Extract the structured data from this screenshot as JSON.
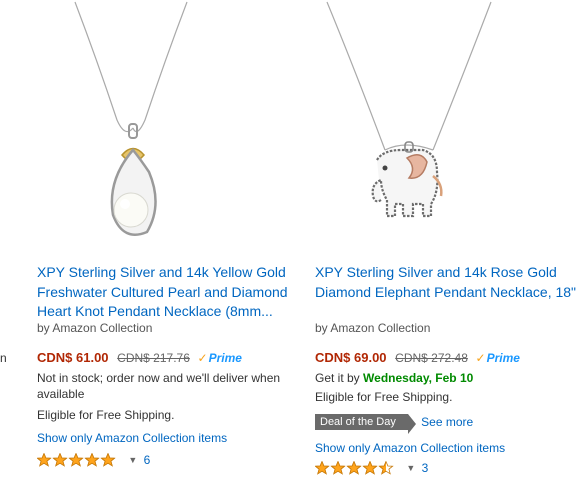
{
  "edge_fragment": "n",
  "products": [
    {
      "title": "XPY Sterling Silver and 14k Yellow Gold Freshwater Cultured Pearl and Diamond Heart Knot Pendant Necklace (8mm...",
      "byline": "by Amazon Collection",
      "price": "CDN$ 61.00",
      "list_price": "CDN$ 217.76",
      "prime_label": "Prime",
      "prime_check": "✓",
      "stock_text": "Not in stock; order now and we'll deliver when available",
      "shipping": "Eligible for Free Shipping.",
      "show_only": "Show only Amazon Collection items",
      "rating": 5,
      "review_count": "6",
      "image_icon": "pearl-heart-knot-pendant"
    },
    {
      "title": "XPY Sterling Silver and 14k Rose Gold Diamond Elephant Pendant Necklace, 18\"",
      "byline": "by Amazon Collection",
      "price": "CDN$ 69.00",
      "list_price": "CDN$ 272.48",
      "prime_label": "Prime",
      "prime_check": "✓",
      "stock_prefix": "Get it by ",
      "stock_date": "Wednesday, Feb 10",
      "shipping": "Eligible for Free Shipping.",
      "deal_badge": "Deal of the Day",
      "deal_link": "See more",
      "show_only": "Show only Amazon Collection items",
      "rating": 4.5,
      "review_count": "3",
      "image_icon": "elephant-pendant"
    }
  ],
  "colors": {
    "link": "#0066c0",
    "price": "#b12704",
    "prime": "#1a98ff",
    "star": "#ffa41c",
    "delivery_date": "#008a00"
  }
}
